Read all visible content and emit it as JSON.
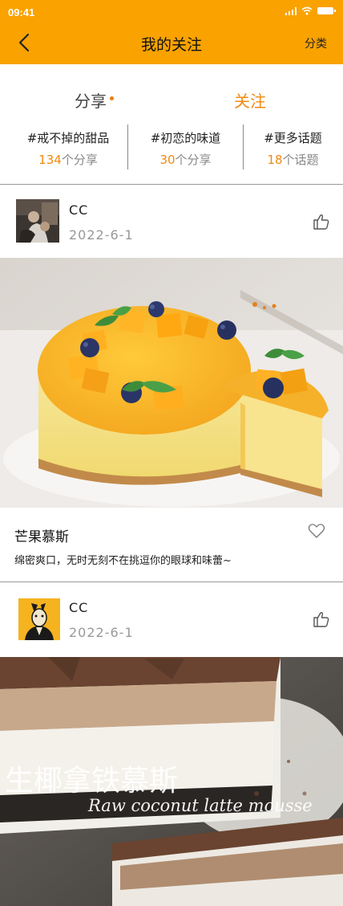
{
  "status_bar": {
    "time": "09:41"
  },
  "header": {
    "title": "我的关注",
    "category_label": "分类",
    "accent_color": "#F9A200"
  },
  "tabs": [
    {
      "label": "分享",
      "active": false
    },
    {
      "label": "关注",
      "active": true
    }
  ],
  "topics": [
    {
      "name": "#戒不掉的甜品",
      "count": "134",
      "unit": "个分享"
    },
    {
      "name": "#初恋的味道",
      "count": "30",
      "unit": "个分享"
    },
    {
      "name": "#更多话题",
      "count": "18",
      "unit": "个话题"
    }
  ],
  "posts": [
    {
      "username": "CC",
      "date": "2022-6-1",
      "title": "芒果慕斯",
      "description": "绵密爽口，无时无刻不在挑逗你的眼球和味蕾~"
    },
    {
      "username": "CC",
      "date": "2022-6-1",
      "image_overlay_cn": "生椰拿铁慕斯",
      "image_overlay_en": "Raw coconut latte mousse"
    }
  ]
}
